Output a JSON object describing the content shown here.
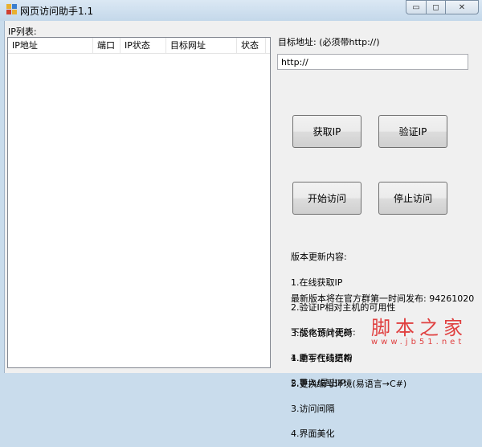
{
  "window": {
    "title": "网页访问助手1.1",
    "minimize": "▭",
    "maximize": "◻",
    "close": "✕"
  },
  "list": {
    "label": "IP列表:",
    "columns": [
      "IP地址",
      "端口",
      "IP状态",
      "目标网址",
      "状态"
    ],
    "rows": []
  },
  "target": {
    "label": "目标地址: (必须带http://)",
    "value": "http://"
  },
  "buttons": {
    "get_ip": "获取IP",
    "verify_ip": "验证IP",
    "start": "开始访问",
    "stop": "停止访问"
  },
  "notes": {
    "changelog_title": "版本更新内容:",
    "changelog": [
      "1.在线获取IP",
      "2.验证IP相对主机的可用性",
      "3.优化访问代码",
      "4.重写代码结构",
      "5.更换编写环境(易语言→C#)"
    ],
    "release": "最新版本将在官方群第一时间发布: 94261020",
    "next_title": "下版本预计更新:",
    "next": [
      "1.助手在线更新",
      "2.导入/导出IP",
      "3.访问间隔",
      "4.界面美化"
    ]
  },
  "watermark": {
    "name": "脚本之家",
    "url": "www.jb51.net"
  }
}
